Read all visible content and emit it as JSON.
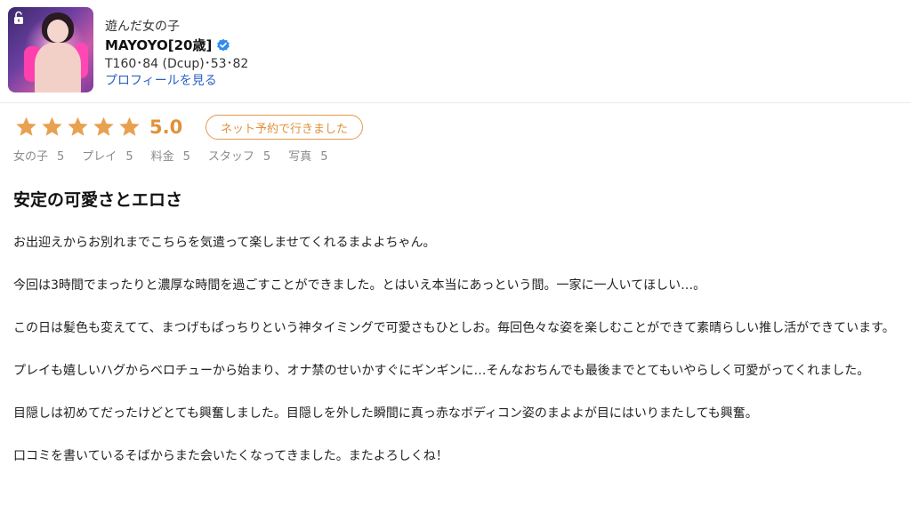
{
  "profile": {
    "category": "遊んだ女の子",
    "name": "MAYOYO[20歳]",
    "stats": "T160･84 (Dcup)･53･82",
    "profile_link": "プロフィールを見る"
  },
  "rating": {
    "stars": 5,
    "score": "5.0",
    "visit_type": "ネット予約で行きました"
  },
  "subscores": [
    {
      "label": "女の子",
      "value": "5"
    },
    {
      "label": "プレイ",
      "value": "5"
    },
    {
      "label": "料金",
      "value": "5"
    },
    {
      "label": "スタッフ",
      "value": "5"
    },
    {
      "label": "写真",
      "value": "5"
    }
  ],
  "review": {
    "title": "安定の可愛さとエロさ",
    "paragraphs": [
      "お出迎えからお別れまでこちらを気遣って楽しませてくれるまよよちゃん。",
      "今回は3時間でまったりと濃厚な時間を過ごすことができました。とはいえ本当にあっという間。一家に一人いてほしい…。",
      "この日は髪色も変えてて、まつげもぱっちりという神タイミングで可愛さもひとしお。毎回色々な姿を楽しむことができて素晴らしい推し活ができています。",
      "プレイも嬉しいハグからベロチューから始まり、オナ禁のせいかすぐにギンギンに…そんなおちんでも最後までとてもいやらしく可愛がってくれました。",
      "目隠しは初めてだったけどとても興奮しました。目隠しを外した瞬間に真っ赤なボディコン姿のまよよが目にはいりまたしても興奮。",
      "口コミを書いているそばからまた会いたくなってきました。またよろしくね！"
    ]
  },
  "colors": {
    "star": "#e8a14f",
    "accent": "#e0913a",
    "link": "#2b62c4",
    "verified": "#2f8cf0"
  },
  "icons": {
    "lock": "unlock-icon",
    "verified": "verified-badge-icon",
    "star": "star-icon"
  }
}
